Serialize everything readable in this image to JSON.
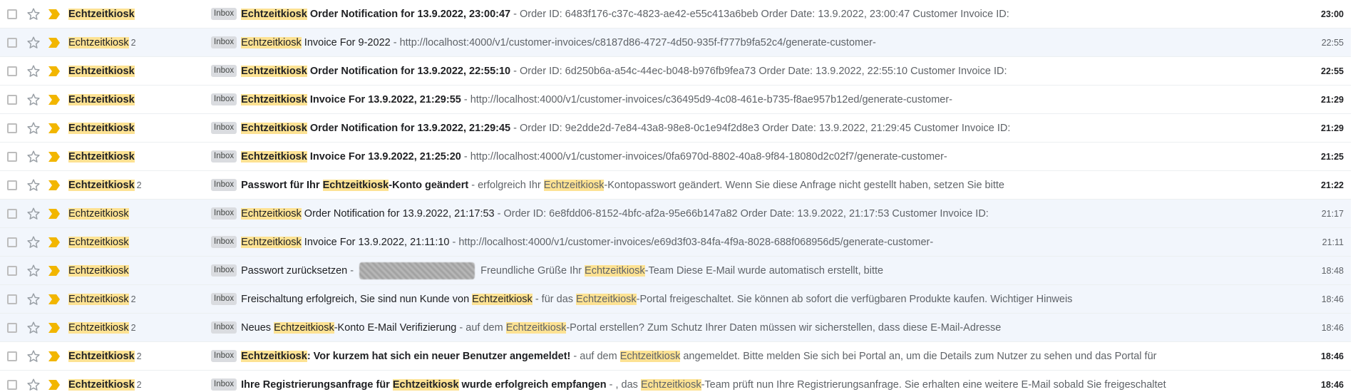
{
  "colors": {
    "highlight": "#fde293",
    "importance": "#f2b600",
    "unread_bg": "#ffffff",
    "read_bg": "#f2f6fc"
  },
  "badge_label": "Inbox",
  "rows": [
    {
      "unread": true,
      "count": "",
      "time": "23:00",
      "subject": [
        "#Echtzeitkiosk",
        " Order Notification for 13.9.2022, 23:00:47"
      ],
      "snippet": [
        " - Order ID: 6483f176-c37c-4823-ae42-e55c413a6beb Order Date: 13.9.2022, 23:00:47 Customer Invoice ID:"
      ]
    },
    {
      "unread": false,
      "count": "2",
      "time": "22:55",
      "subject": [
        "#Echtzeitkiosk",
        " Invoice For 9-2022"
      ],
      "snippet": [
        " - http://localhost:4000/v1/customer-invoices/c8187d86-4727-4d50-935f-f777b9fa52c4/generate-customer-"
      ]
    },
    {
      "unread": true,
      "count": "",
      "time": "22:55",
      "subject": [
        "#Echtzeitkiosk",
        " Order Notification for 13.9.2022, 22:55:10"
      ],
      "snippet": [
        " - Order ID: 6d250b6a-a54c-44ec-b048-b976fb9fea73 Order Date: 13.9.2022, 22:55:10 Customer Invoice ID:"
      ]
    },
    {
      "unread": true,
      "count": "",
      "time": "21:29",
      "subject": [
        "#Echtzeitkiosk",
        " Invoice For 13.9.2022, 21:29:55"
      ],
      "snippet": [
        " - http://localhost:4000/v1/customer-invoices/c36495d9-4c08-461e-b735-f8ae957b12ed/generate-customer-"
      ]
    },
    {
      "unread": true,
      "count": "",
      "time": "21:29",
      "subject": [
        "#Echtzeitkiosk",
        " Order Notification for 13.9.2022, 21:29:45"
      ],
      "snippet": [
        " - Order ID: 9e2dde2d-7e84-43a8-98e8-0c1e94f2d8e3 Order Date: 13.9.2022, 21:29:45 Customer Invoice ID:"
      ]
    },
    {
      "unread": true,
      "count": "",
      "time": "21:25",
      "subject": [
        "#Echtzeitkiosk",
        " Invoice For 13.9.2022, 21:25:20"
      ],
      "snippet": [
        " - http://localhost:4000/v1/customer-invoices/0fa6970d-8802-40a8-9f84-18080d2c02f7/generate-customer-"
      ]
    },
    {
      "unread": true,
      "count": "2",
      "time": "21:22",
      "subject": [
        "Passwort für Ihr ",
        "#Echtzeitkiosk",
        "-Konto geändert"
      ],
      "snippet": [
        " - erfolgreich Ihr ",
        "#Echtzeitkiosk",
        "-Kontopasswort geändert. Wenn Sie diese Anfrage nicht gestellt haben, setzen Sie bitte"
      ]
    },
    {
      "unread": false,
      "count": "",
      "time": "21:17",
      "subject": [
        "#Echtzeitkiosk",
        " Order Notification for 13.9.2022, 21:17:53"
      ],
      "snippet": [
        " - Order ID: 6e8fdd06-8152-4bfc-af2a-95e66b147a82 Order Date: 13.9.2022, 21:17:53 Customer Invoice ID:"
      ]
    },
    {
      "unread": false,
      "count": "",
      "time": "21:11",
      "subject": [
        "#Echtzeitkiosk",
        " Invoice For 13.9.2022, 21:11:10"
      ],
      "snippet": [
        " - http://localhost:4000/v1/customer-invoices/e69d3f03-84fa-4f9a-8028-688f068956d5/generate-customer-"
      ]
    },
    {
      "unread": false,
      "count": "",
      "time": "18:48",
      "redacted": true,
      "subject": [
        "Passwort zurücksetzen"
      ],
      "snippet": [
        " - ",
        "@@REDACT",
        " Freundliche Grüße Ihr ",
        "#Echtzeitkiosk",
        "-Team Diese E-Mail wurde automatisch erstellt, bitte"
      ]
    },
    {
      "unread": false,
      "count": "2",
      "time": "18:46",
      "subject": [
        "Freischaltung erfolgreich, Sie sind nun Kunde von ",
        "#Echtzeitkiosk"
      ],
      "snippet": [
        " - für das ",
        "#Echtzeitkiosk",
        "-Portal freigeschaltet. Sie können ab sofort die verfügbaren Produkte kaufen. Wichtiger Hinweis"
      ]
    },
    {
      "unread": false,
      "count": "2",
      "time": "18:46",
      "subject": [
        "Neues ",
        "#Echtzeitkiosk",
        "-Konto E-Mail Verifizierung"
      ],
      "snippet": [
        " - auf dem ",
        "#Echtzeitkiosk",
        "-Portal erstellen? Zum Schutz Ihrer Daten müssen wir sicherstellen, dass diese E-Mail-Adresse"
      ]
    },
    {
      "unread": true,
      "count": "2",
      "time": "18:46",
      "subject": [
        "#Echtzeitkiosk",
        ": Vor kurzem hat sich ein neuer Benutzer angemeldet!"
      ],
      "snippet": [
        " - auf dem ",
        "#Echtzeitkiosk",
        " angemeldet. Bitte melden Sie sich bei Portal an, um die Details zum Nutzer zu sehen und das Portal für"
      ]
    },
    {
      "unread": true,
      "count": "2",
      "time": "18:46",
      "subject": [
        "Ihre Registrierungsanfrage für ",
        "#Echtzeitkiosk",
        " wurde erfolgreich empfangen"
      ],
      "snippet": [
        " - , das ",
        "#Echtzeitkiosk",
        "-Team prüft nun Ihre Registrierungsanfrage. Sie erhalten eine weitere E-Mail sobald Sie freigeschaltet"
      ]
    }
  ],
  "sender": "Echtzeitkiosk"
}
